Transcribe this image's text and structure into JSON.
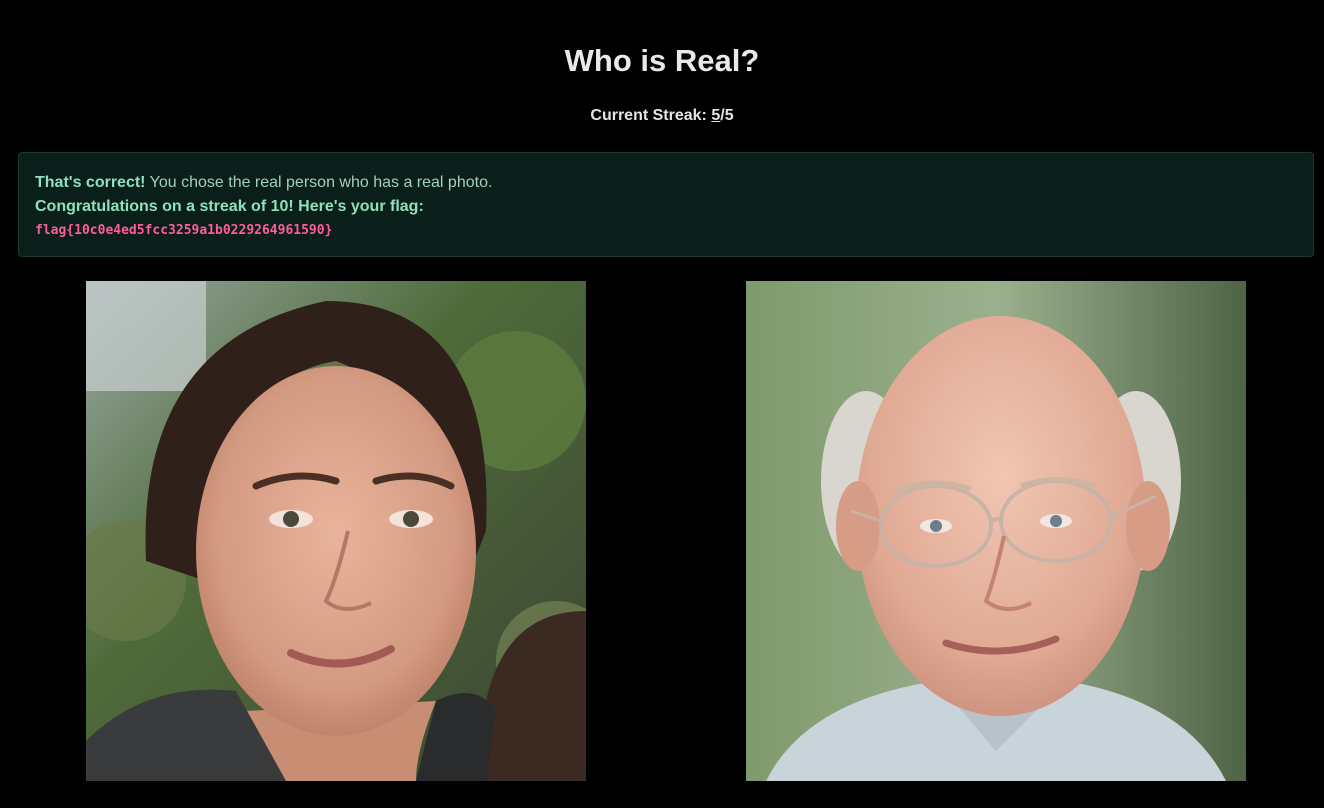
{
  "header": {
    "title": "Who is Real?",
    "streak_label": "Current Streak:",
    "streak_current": "5",
    "streak_separator": "/",
    "streak_total": "5"
  },
  "alert": {
    "result_strong": "That's correct!",
    "result_text": " You chose the real person who has a real photo.",
    "congrats": "Congratulations on a streak of 10! Here's your flag:",
    "flag": "flag{10c0e4ed5fcc3259a1b0229264961590}"
  },
  "choices": [
    {
      "icon": "face-photo-left",
      "description_shown": false
    },
    {
      "icon": "face-photo-right",
      "description_shown": false
    }
  ],
  "colors": {
    "background": "#000000",
    "alert_bg": "#0a1f19",
    "alert_text": "#8fe0bb",
    "flag_text": "#ff5c9e"
  }
}
